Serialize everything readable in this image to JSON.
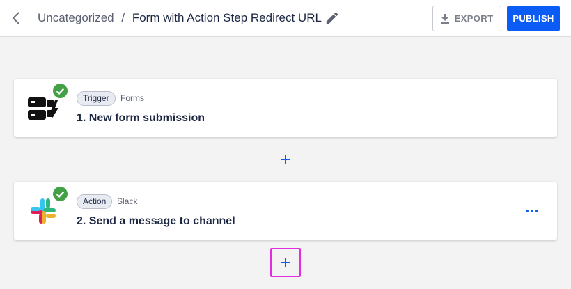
{
  "header": {
    "breadcrumb_parent": "Uncategorized",
    "breadcrumb_separator": "/",
    "title": "Form with Action Step Redirect URL",
    "export_label": "EXPORT",
    "publish_label": "PUBLISH"
  },
  "icons": {
    "back": "chevron-left-icon",
    "edit": "pencil-icon",
    "export": "download-icon",
    "check": "check-circle-icon",
    "more": "more-horizontal-icon",
    "add": "plus-icon"
  },
  "steps": [
    {
      "type_label": "Trigger",
      "app": "Forms",
      "title": "1. New form submission",
      "status": "complete"
    },
    {
      "type_label": "Action",
      "app": "Slack",
      "title": "2. Send a message to channel",
      "status": "complete"
    }
  ],
  "colors": {
    "accent": "#0a5cf5",
    "success": "#43a047",
    "highlight": "#e12fe0"
  }
}
